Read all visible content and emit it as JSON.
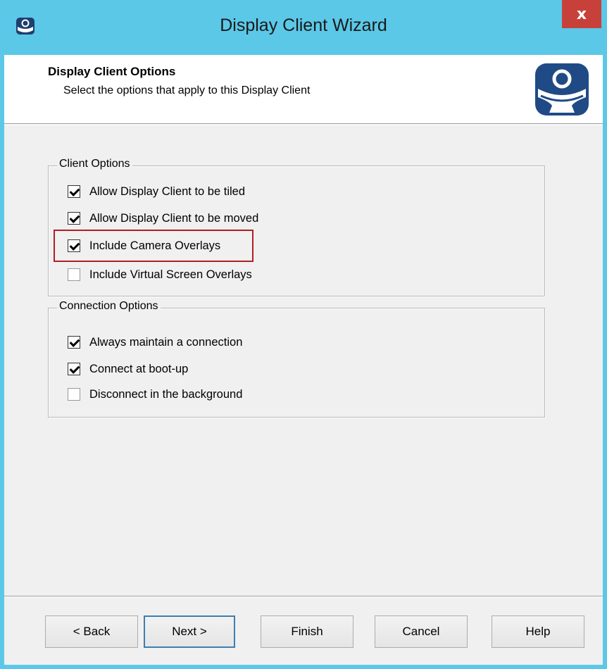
{
  "window": {
    "title": "Display Client Wizard",
    "close_label": "x",
    "icon": "thinmanager-icon"
  },
  "header": {
    "title": "Display Client Options",
    "subtitle": "Select the options that apply to this Display Client",
    "logo": "thinmanager-logo"
  },
  "client_options": {
    "legend": "Client Options",
    "items": [
      {
        "label": "Allow Display Client to be tiled",
        "checked": true
      },
      {
        "label": "Allow Display Client to be moved",
        "checked": true
      },
      {
        "label": "Include Camera Overlays",
        "checked": true,
        "highlighted": true
      },
      {
        "label": "Include Virtual Screen Overlays",
        "checked": false
      }
    ]
  },
  "connection_options": {
    "legend": "Connection Options",
    "items": [
      {
        "label": "Always maintain a connection",
        "checked": true
      },
      {
        "label": "Connect at boot-up",
        "checked": true
      },
      {
        "label": "Disconnect in the background",
        "checked": false
      }
    ]
  },
  "buttons": {
    "back": "< Back",
    "next": "Next >",
    "finish": "Finish",
    "cancel": "Cancel",
    "help": "Help"
  },
  "colors": {
    "titlebar": "#5bc8e8",
    "close": "#c7413a",
    "highlight": "#b11f24"
  }
}
